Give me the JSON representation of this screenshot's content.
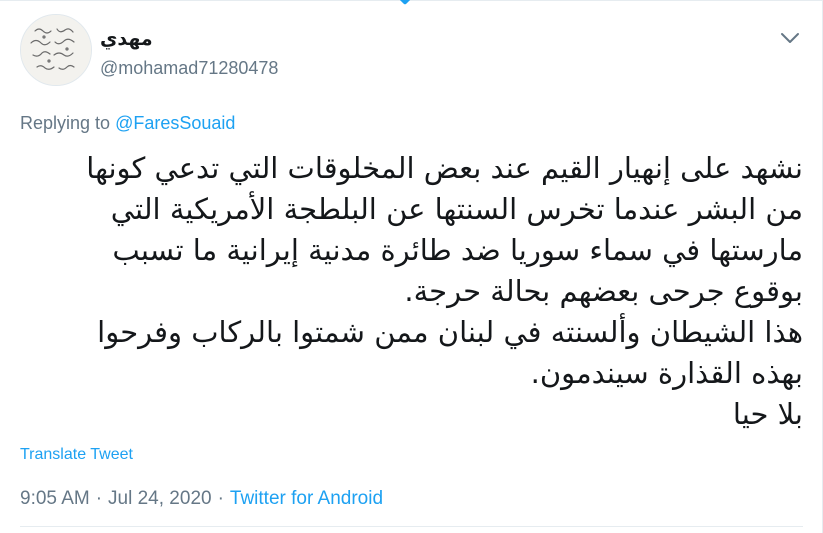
{
  "tweet": {
    "display_name": "مهدي",
    "handle": "@mohamad71280478",
    "replying_prefix": "Replying to ",
    "replying_to": "@FaresSouaid",
    "lines": [
      "نشهد على إنهيار القيم عند بعض المخلوقات التي تدعي كونها",
      "من البشر عندما تخرس السنتها عن البلطجة الأمريكية التي",
      "مارستها في سماء سوريا ضد طائرة مدنية إيرانية ما تسبب",
      "بوقوع جرحى بعضهم بحالة حرجة.",
      "هذا الشيطان وألسنته في لبنان ممن شمتوا بالركاب وفرحوا",
      "بهذه القذارة  سيندمون.",
      "بلا حيا"
    ],
    "translate_label": "Translate Tweet",
    "time": "9:05 AM",
    "separator1": "·",
    "date": "Jul 24, 2020",
    "separator2": "·",
    "source": "Twitter for Android"
  },
  "icons": {
    "avatar": "handwriting-avatar-image",
    "menu": "chevron-down-icon"
  },
  "colors": {
    "accent": "#1da1f2",
    "secondary_text": "#657786",
    "primary_text": "#14171a"
  }
}
